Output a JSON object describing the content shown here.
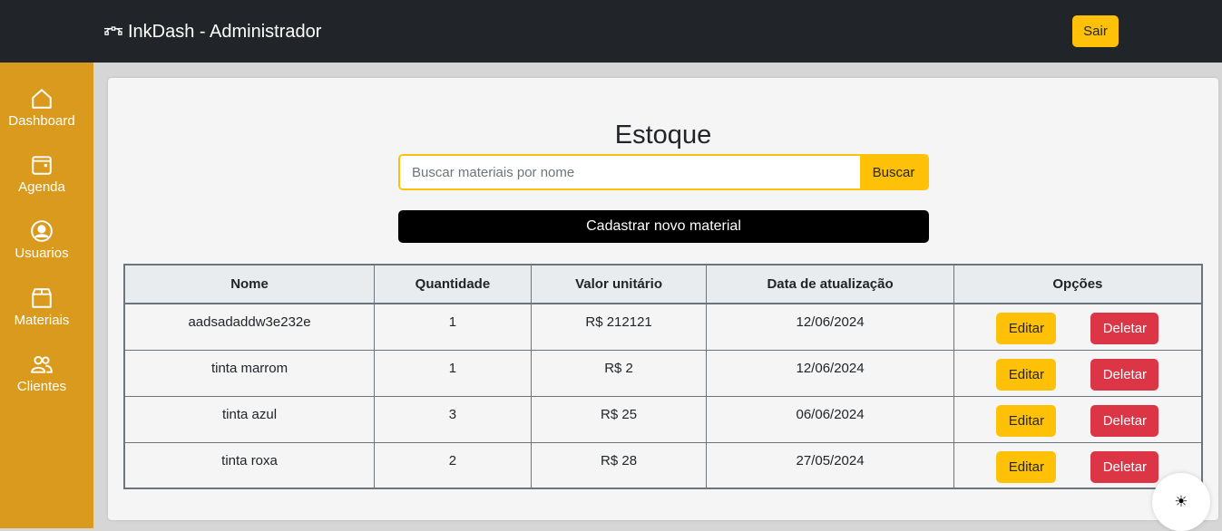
{
  "header": {
    "title": "InkDash - Administrador",
    "logout_label": "Sair"
  },
  "sidebar": {
    "items": [
      {
        "label": "Dashboard",
        "icon": "home-icon"
      },
      {
        "label": "Agenda",
        "icon": "calendar-icon"
      },
      {
        "label": "Usuarios",
        "icon": "user-circle-icon"
      },
      {
        "label": "Materiais",
        "icon": "box-icon"
      },
      {
        "label": "Clientes",
        "icon": "users-icon"
      }
    ]
  },
  "main": {
    "title": "Estoque",
    "search": {
      "placeholder": "Buscar materiais por nome",
      "value": "",
      "button_label": "Buscar"
    },
    "new_button_label": "Cadastrar novo material",
    "table": {
      "headers": [
        "Nome",
        "Quantidade",
        "Valor unitário",
        "Data de atualização",
        "Opções"
      ],
      "rows": [
        {
          "nome": "aadsadaddw3e232e",
          "quantidade": "1",
          "valor": "R$ 212121",
          "data": "12/06/2024"
        },
        {
          "nome": "tinta marrom",
          "quantidade": "1",
          "valor": "R$ 2",
          "data": "12/06/2024"
        },
        {
          "nome": "tinta azul",
          "quantidade": "3",
          "valor": "R$ 25",
          "data": "06/06/2024"
        },
        {
          "nome": "tinta roxa",
          "quantidade": "2",
          "valor": "R$ 28",
          "data": "27/05/2024"
        }
      ],
      "edit_label": "Editar",
      "delete_label": "Deletar"
    }
  },
  "theme_toggle": {
    "icon": "sun-icon",
    "glyph": "☀"
  },
  "colors": {
    "topbar": "#212529",
    "sidebar": "#d99a1d",
    "accent": "#ffc107",
    "danger": "#dc3545"
  }
}
